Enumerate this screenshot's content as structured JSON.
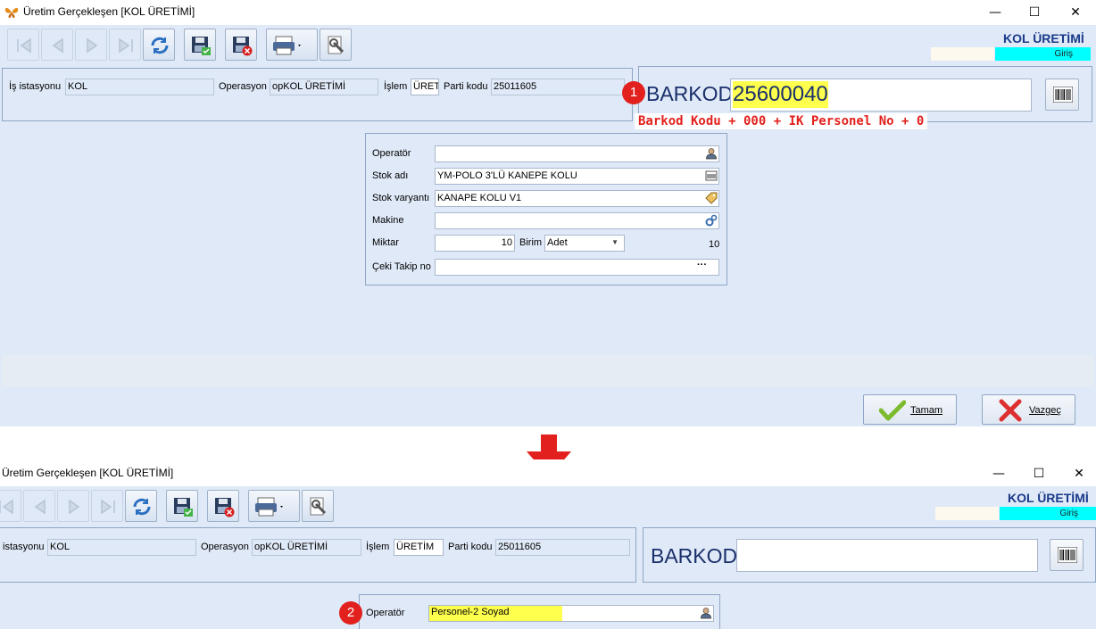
{
  "top": {
    "window_title": "Üretim Gerçekleşen [KOL ÜRETİMİ]",
    "header_title": "KOL ÜRETİMİ",
    "mode_label": "Giriş",
    "info": {
      "is_istasyonu_label": "İş istasyonu",
      "is_istasyonu_value": "KOL",
      "operasyon_label": "Operasyon",
      "operasyon_value": "opKOL ÜRETİMİ",
      "islem_label": "İşlem",
      "islem_value": "ÜRETİ",
      "parti_kodu_label": "Parti kodu",
      "parti_kodu_value": "25011605"
    },
    "barkod_label": "BARKOD",
    "barkod_value": "25600040",
    "badge": "1",
    "annotation": "Barkod Kodu + 000 + IK Personel No + 0",
    "form": {
      "operator_label": "Operatör",
      "operator_value": "",
      "stok_adi_label": "Stok adı",
      "stok_adi_value": "YM-POLO 3'LÜ KANEPE KOLU",
      "stok_varyanti_label": "Stok varyantı",
      "stok_varyanti_value": "KANAPE KOLU V1",
      "makine_label": "Makine",
      "makine_value": "",
      "miktar_label": "Miktar",
      "miktar_value": "10",
      "birim_label": "Birim",
      "birim_value": "Adet",
      "miktar_total": "10",
      "ceki_label": "Çeki Takip no",
      "ceki_value": "",
      "ceki_button": "···"
    },
    "ok_button": "Tamam",
    "cancel_button": "Vazgeç"
  },
  "bottom": {
    "window_title": "Üretim Gerçekleşen [KOL ÜRETİMİ]",
    "header_title": "KOL ÜRETİMİ",
    "mode_label": "Giriş",
    "info": {
      "is_istasyonu_label": "istasyonu",
      "is_istasyonu_value": "KOL",
      "operasyon_label": "Operasyon",
      "operasyon_value": "opKOL ÜRETİMİ",
      "islem_label": "İşlem",
      "islem_value": "ÜRETİM",
      "parti_kodu_label": "Parti kodu",
      "parti_kodu_value": "25011605"
    },
    "barkod_label": "BARKOD",
    "barkod_value": "",
    "badge": "2",
    "form": {
      "operator_label": "Operatör",
      "operator_value": "Personel-2 Soyad"
    }
  },
  "colors": {
    "accent_red": "#e2201d",
    "highlight": "#ffff4d",
    "mode_cyan": "#00ffff",
    "window_bg": "#dfe9f7",
    "title_blue": "#1a3a8a"
  }
}
